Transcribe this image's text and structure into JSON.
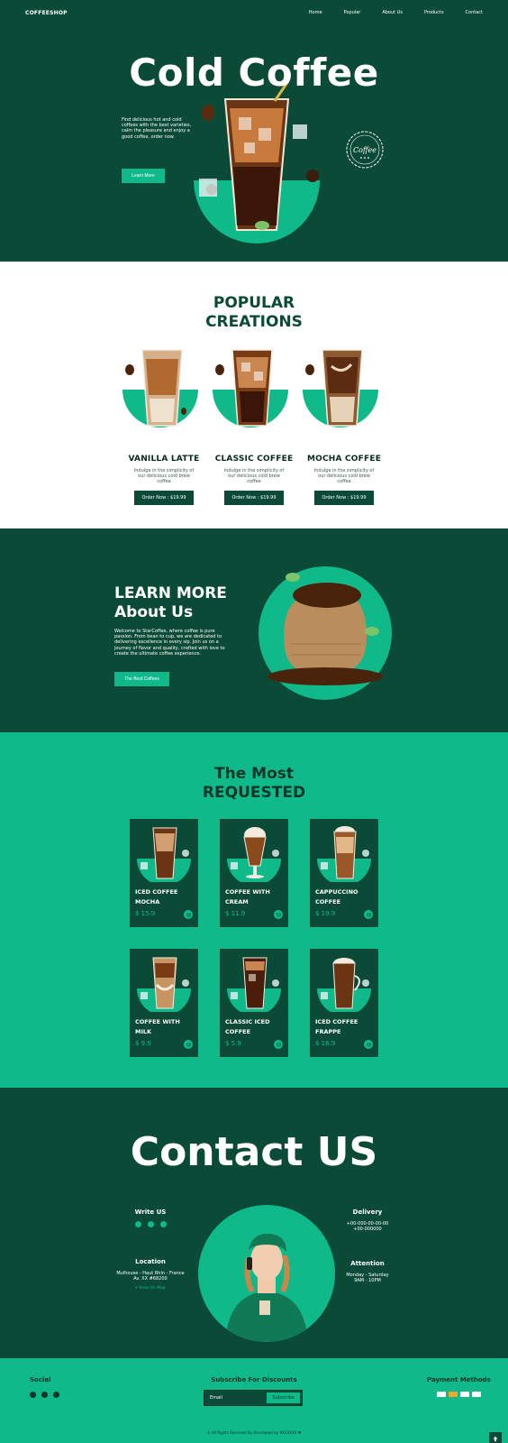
{
  "nav": {
    "brand": "COFFEESHOP",
    "links": [
      "Home",
      "Popular",
      "About Us",
      "Products",
      "Contact"
    ]
  },
  "hero": {
    "title": "Cold Coffee",
    "text": "Find delicious hot and cold coffees with the best varieties, calm the pleasure and enjoy a good coffee, order now.",
    "button": "Learn More",
    "seal_text": "Coffee"
  },
  "popular": {
    "title_line1": "POPULAR",
    "title_line2": "CREATIONS",
    "items": [
      {
        "name": "VANILLA LATTE",
        "desc": "Indulge in the simplicity of our delicious cold brew coffee",
        "button": "Order Now : $19.99"
      },
      {
        "name": "CLASSIC COFFEE",
        "desc": "Indulge in the simplicity of our delicious cold brew coffee",
        "button": "Order Now : $19.99"
      },
      {
        "name": "MOCHA COFFEE",
        "desc": "Indulge in the simplicity of our delicious cold brew coffee",
        "button": "Order Now : $19.99"
      }
    ]
  },
  "about": {
    "title_line1": "LEARN MORE",
    "title_line2": "About Us",
    "text": "Welcome to StarCoffee, where coffee is pure passion. From bean to cup, we are dedicated to delivering excellence in every sip. Join us on a journey of flavor and quality, crafted with love to create the ultimate coffee experience.",
    "button": "The Best Coffees"
  },
  "requested": {
    "title_line1": "The Most",
    "title_line2": "REQUESTED",
    "items": [
      {
        "name": "ICED COFFEE MOCHA",
        "price": "$ 15.9"
      },
      {
        "name": "COFFEE WITH CREAM",
        "price": "$ 11.9"
      },
      {
        "name": "CAPPUCCINO COFFEE",
        "price": "$ 19.9"
      },
      {
        "name": "COFFEE WITH MILK",
        "price": "$ 9.9"
      },
      {
        "name": "CLASSIC ICED COFFEE",
        "price": "$ 5.9"
      },
      {
        "name": "ICED COFFEE FRAPPE",
        "price": "$ 16.9"
      }
    ]
  },
  "contact": {
    "title": "Contact US",
    "write": {
      "heading": "Write US"
    },
    "delivery": {
      "heading": "Delivery",
      "line1": "+00-000-00-00-00",
      "line2": "+00-000000"
    },
    "location": {
      "heading": "Location",
      "line1": "Mulhouse - Haut Rhin - France",
      "line2": "Av. XX #68200",
      "link": "View On Map"
    },
    "attention": {
      "heading": "Attention",
      "line1": "Monday - Saturday",
      "line2": "9AM - 10PM"
    }
  },
  "footer": {
    "social_heading": "Social",
    "subscribe_heading": "Subscribe For Discounts",
    "email_placeholder": "Email",
    "subscribe_button": "Subscribe",
    "payment_heading": "Payment Methods",
    "copyright": "© All Rights Reserved By Developed by XXXXXXX ♥"
  },
  "colors": {
    "dark_green": "#0b4a36",
    "accent_green": "#10b98a",
    "white": "#ffffff"
  }
}
